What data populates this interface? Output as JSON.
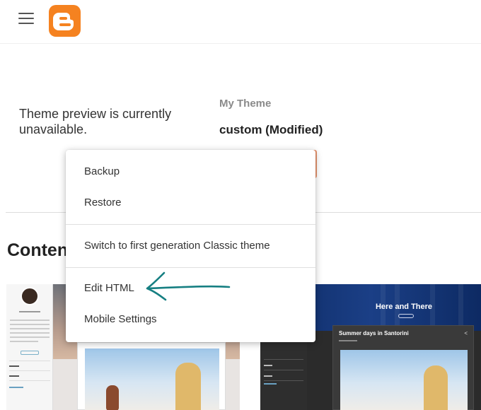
{
  "app": {
    "name": "Blogger",
    "brand_color": "#f58220"
  },
  "header": {
    "menu_icon": "hamburger-menu-icon",
    "logo_icon": "blogger-logo-icon"
  },
  "theme_panel": {
    "preview_message": "Theme preview is currently unavailable.",
    "my_theme_label": "My Theme",
    "theme_name": "custom (Modified)"
  },
  "section": {
    "title": "Conten"
  },
  "thumbnails": {
    "right_title": "Here and There",
    "right_post_title": "Summer days in Santorini",
    "right_share_glyph": "<"
  },
  "menu": {
    "items": [
      {
        "label": "Backup"
      },
      {
        "label": "Restore"
      },
      {
        "label": "Switch to first generation Classic theme"
      },
      {
        "label": "Edit HTML"
      },
      {
        "label": "Mobile Settings"
      }
    ]
  },
  "annotation": {
    "arrow_color": "#167f82"
  }
}
